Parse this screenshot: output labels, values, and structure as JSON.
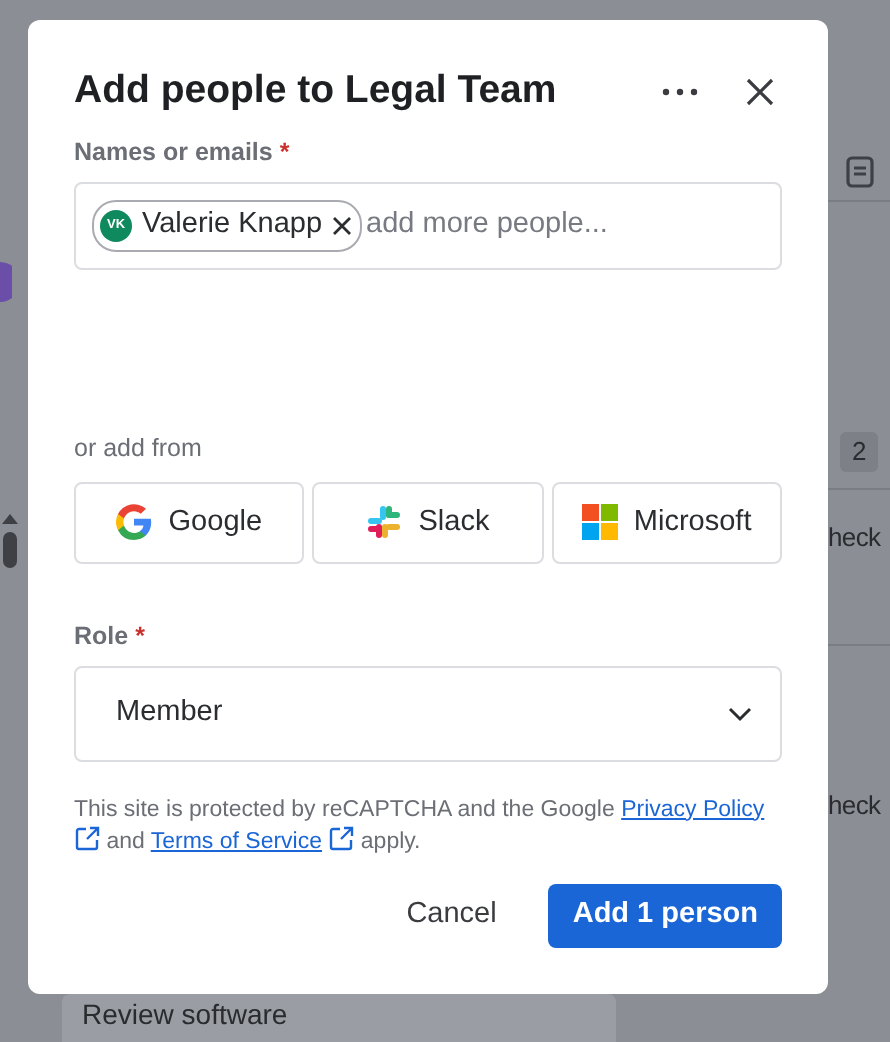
{
  "background": {
    "badge": "2",
    "row_texts": [
      "heck",
      "heck"
    ],
    "task_card": "Review software"
  },
  "dialog": {
    "title": "Add people to Legal Team",
    "names_field": {
      "label": "Names or emails",
      "required_mark": "*",
      "chips": [
        {
          "initials": "VK",
          "name": "Valerie Knapp"
        }
      ],
      "placeholder": "add more people..."
    },
    "add_from_label": "or add from",
    "providers": [
      {
        "kind": "google",
        "label": "Google"
      },
      {
        "kind": "slack",
        "label": "Slack"
      },
      {
        "kind": "microsoft",
        "label": "Microsoft"
      }
    ],
    "role": {
      "label": "Role",
      "required_mark": "*",
      "value": "Member"
    },
    "notice": [
      {
        "kind": "text",
        "text": "This site is protected by reCAPTCHA and the Google "
      },
      {
        "kind": "link",
        "text": "Privacy Policy"
      },
      {
        "kind": "text",
        "text": " and "
      },
      {
        "kind": "link",
        "text": "Terms of Service"
      },
      {
        "kind": "text",
        "text": " apply."
      }
    ],
    "cancel_button": "Cancel",
    "submit_button": "Add 1 person"
  }
}
